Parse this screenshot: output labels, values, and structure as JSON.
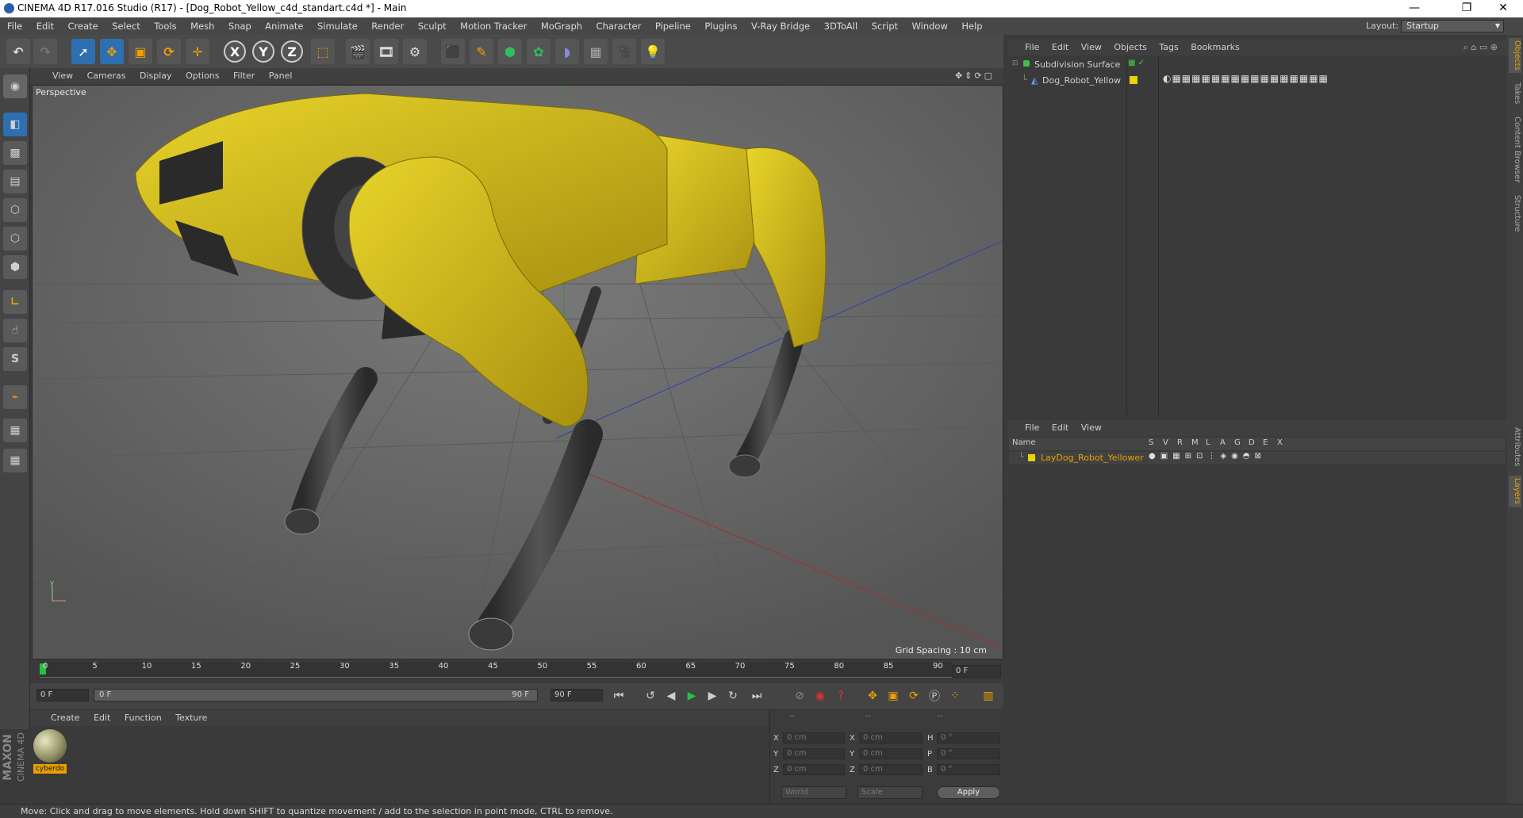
{
  "title": "CINEMA 4D R17.016 Studio (R17) - [Dog_Robot_Yellow_c4d_standart.c4d *] - Main",
  "window_controls": [
    "—",
    "❐",
    "✕"
  ],
  "menu": [
    "File",
    "Edit",
    "Create",
    "Select",
    "Tools",
    "Mesh",
    "Snap",
    "Animate",
    "Simulate",
    "Render",
    "Sculpt",
    "Motion Tracker",
    "MoGraph",
    "Character",
    "Pipeline",
    "Plugins",
    "V-Ray Bridge",
    "3DToAll",
    "Script",
    "Window",
    "Help"
  ],
  "layout": {
    "label": "Layout:",
    "value": "Startup"
  },
  "toolbar_axes": [
    "X",
    "Y",
    "Z"
  ],
  "viewport": {
    "menu": [
      "View",
      "Cameras",
      "Display",
      "Options",
      "Filter",
      "Panel"
    ],
    "label": "Perspective",
    "grid_spacing": "Grid Spacing : 10 cm"
  },
  "timeline": {
    "ticks": [
      "0",
      "5",
      "10",
      "15",
      "20",
      "25",
      "30",
      "35",
      "40",
      "45",
      "50",
      "55",
      "60",
      "65",
      "70",
      "75",
      "80",
      "85",
      "90"
    ],
    "current_frame": "0 F",
    "start": "0 F",
    "range_start": "0 F",
    "range_end": "90 F",
    "end": "90 F"
  },
  "material": {
    "menu": [
      "Create",
      "Edit",
      "Function",
      "Texture"
    ],
    "name": "cyberdo"
  },
  "coords": {
    "headers": [
      "--",
      "--",
      "--"
    ],
    "rows": [
      {
        "a": "X",
        "av": "0 cm",
        "b": "X",
        "bv": "0 cm",
        "c": "H",
        "cv": "0 °"
      },
      {
        "a": "Y",
        "av": "0 cm",
        "b": "Y",
        "bv": "0 cm",
        "c": "P",
        "cv": "0 °"
      },
      {
        "a": "Z",
        "av": "0 cm",
        "b": "Z",
        "bv": "0 cm",
        "c": "B",
        "cv": "0 °"
      }
    ],
    "world": "World",
    "scale": "Scale",
    "apply": "Apply"
  },
  "objects": {
    "menu": [
      "File",
      "Edit",
      "View",
      "Objects",
      "Tags",
      "Bookmarks"
    ],
    "items": [
      "Subdivision Surface",
      "Dog_Robot_Yellow"
    ]
  },
  "layers": {
    "menu": [
      "File",
      "Edit",
      "View"
    ],
    "columns": [
      "Name",
      "S",
      "V",
      "R",
      "M",
      "L",
      "A",
      "G",
      "D",
      "E",
      "X"
    ],
    "items": [
      "LayDog_Robot_Yellower"
    ]
  },
  "side_tabs": [
    "Objects",
    "Takes",
    "Content Browser",
    "Structure",
    "Attributes",
    "Layers"
  ],
  "brand": [
    "MAXON",
    "CINEMA 4D"
  ],
  "status": "Move: Click and drag to move elements. Hold down SHIFT to quantize movement / add to the selection in point mode, CTRL to remove.",
  "colors": {
    "accent": "#e8a000",
    "robot_yellow": "#d8c21a",
    "viewport_bg": "#6a6a6a"
  }
}
